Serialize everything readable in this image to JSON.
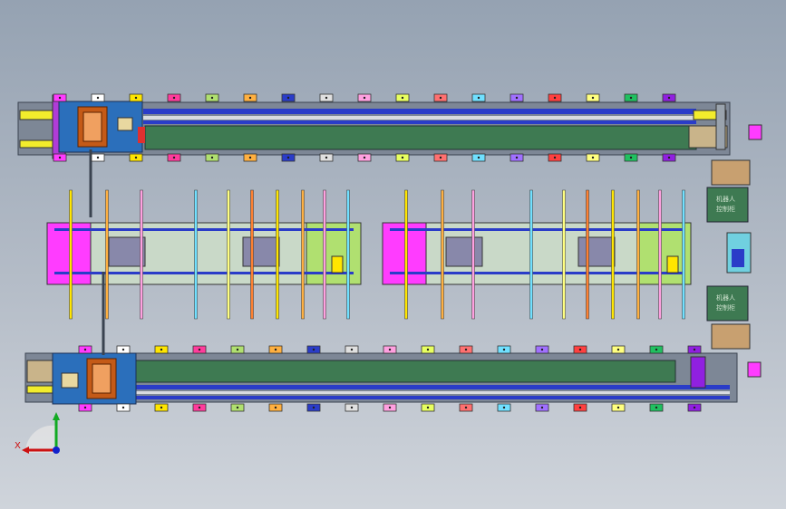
{
  "view": {
    "background_top": "#95a2b2",
    "background_bottom": "#cfd4db",
    "belt_color": "#3e7a52",
    "rail_blue": "#2a3cc8",
    "frame_color": "#3a4350"
  },
  "labels": {
    "panel_top": [
      "机器人",
      "控制柜"
    ],
    "panel_bottom": [
      "机器人",
      "控制柜"
    ]
  },
  "axis_triad": {
    "x_label": "X",
    "x_color": "#cc1111",
    "y_color": "#11aa22",
    "z_color": "#1122cc"
  },
  "icons": {
    "triad": "coordinate-triad-icon",
    "robot": "robot-arm-icon",
    "pendant": "teach-pendant-icon"
  },
  "fixture_colors": [
    "#ff3cff",
    "#ffffff",
    "#ffe600",
    "#ff3c9c",
    "#b0e070",
    "#ffb040",
    "#2a3cc8",
    "#e0e0e0",
    "#ffa0e0",
    "#e8ff60",
    "#ff7070",
    "#70e0ff",
    "#a070ff",
    "#ff4040",
    "#ffff80",
    "#20c060",
    "#9020e0",
    "#ff8030"
  ]
}
